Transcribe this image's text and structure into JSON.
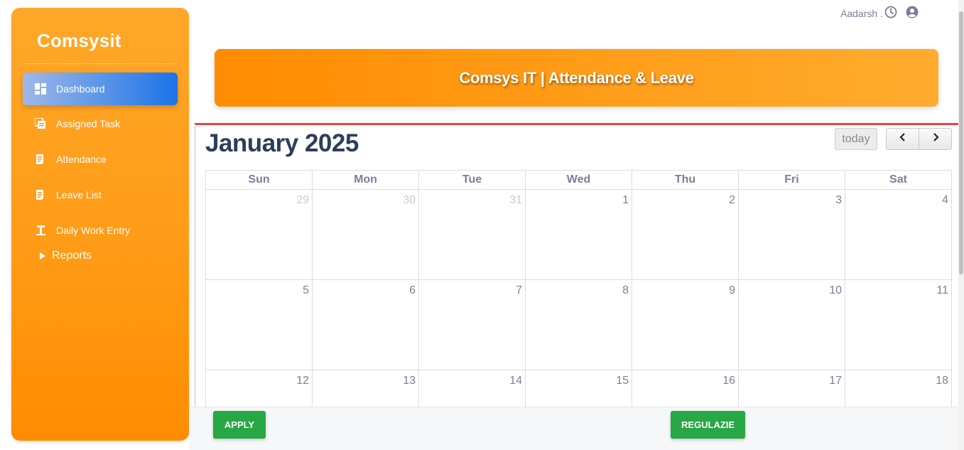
{
  "sidebar": {
    "brand": "Comsysit",
    "items": [
      {
        "label": "Dashboard",
        "icon": "dashboard-icon"
      },
      {
        "label": "Assigned Task",
        "icon": "tasks-icon"
      },
      {
        "label": "Attendance",
        "icon": "receipt-icon"
      },
      {
        "label": "Leave List",
        "icon": "receipt-icon"
      },
      {
        "label": "Daily Work Entry",
        "icon": "work-entry-icon"
      }
    ],
    "reports_label": "Reports"
  },
  "header": {
    "user_name": "Aadarsh .",
    "banner_title": "Comsys IT | Attendance & Leave"
  },
  "calendar": {
    "month_title": "January 2025",
    "today_label": "today",
    "weekdays": [
      "Sun",
      "Mon",
      "Tue",
      "Wed",
      "Thu",
      "Fri",
      "Sat"
    ],
    "weeks": [
      [
        "29",
        "30",
        "31",
        "1",
        "2",
        "3",
        "4"
      ],
      [
        "5",
        "6",
        "7",
        "8",
        "9",
        "10",
        "11"
      ],
      [
        "12",
        "13",
        "14",
        "15",
        "16",
        "17",
        "18"
      ]
    ]
  },
  "footer": {
    "apply_label": "APPLY",
    "regulazie_label": "REGULAZIE"
  },
  "colors": {
    "brand_orange": "#ff9a14",
    "active_blue": "#1b73e8",
    "title_navy": "#2c3e5a",
    "accent_red": "#e0473f",
    "button_green": "#28a745"
  }
}
